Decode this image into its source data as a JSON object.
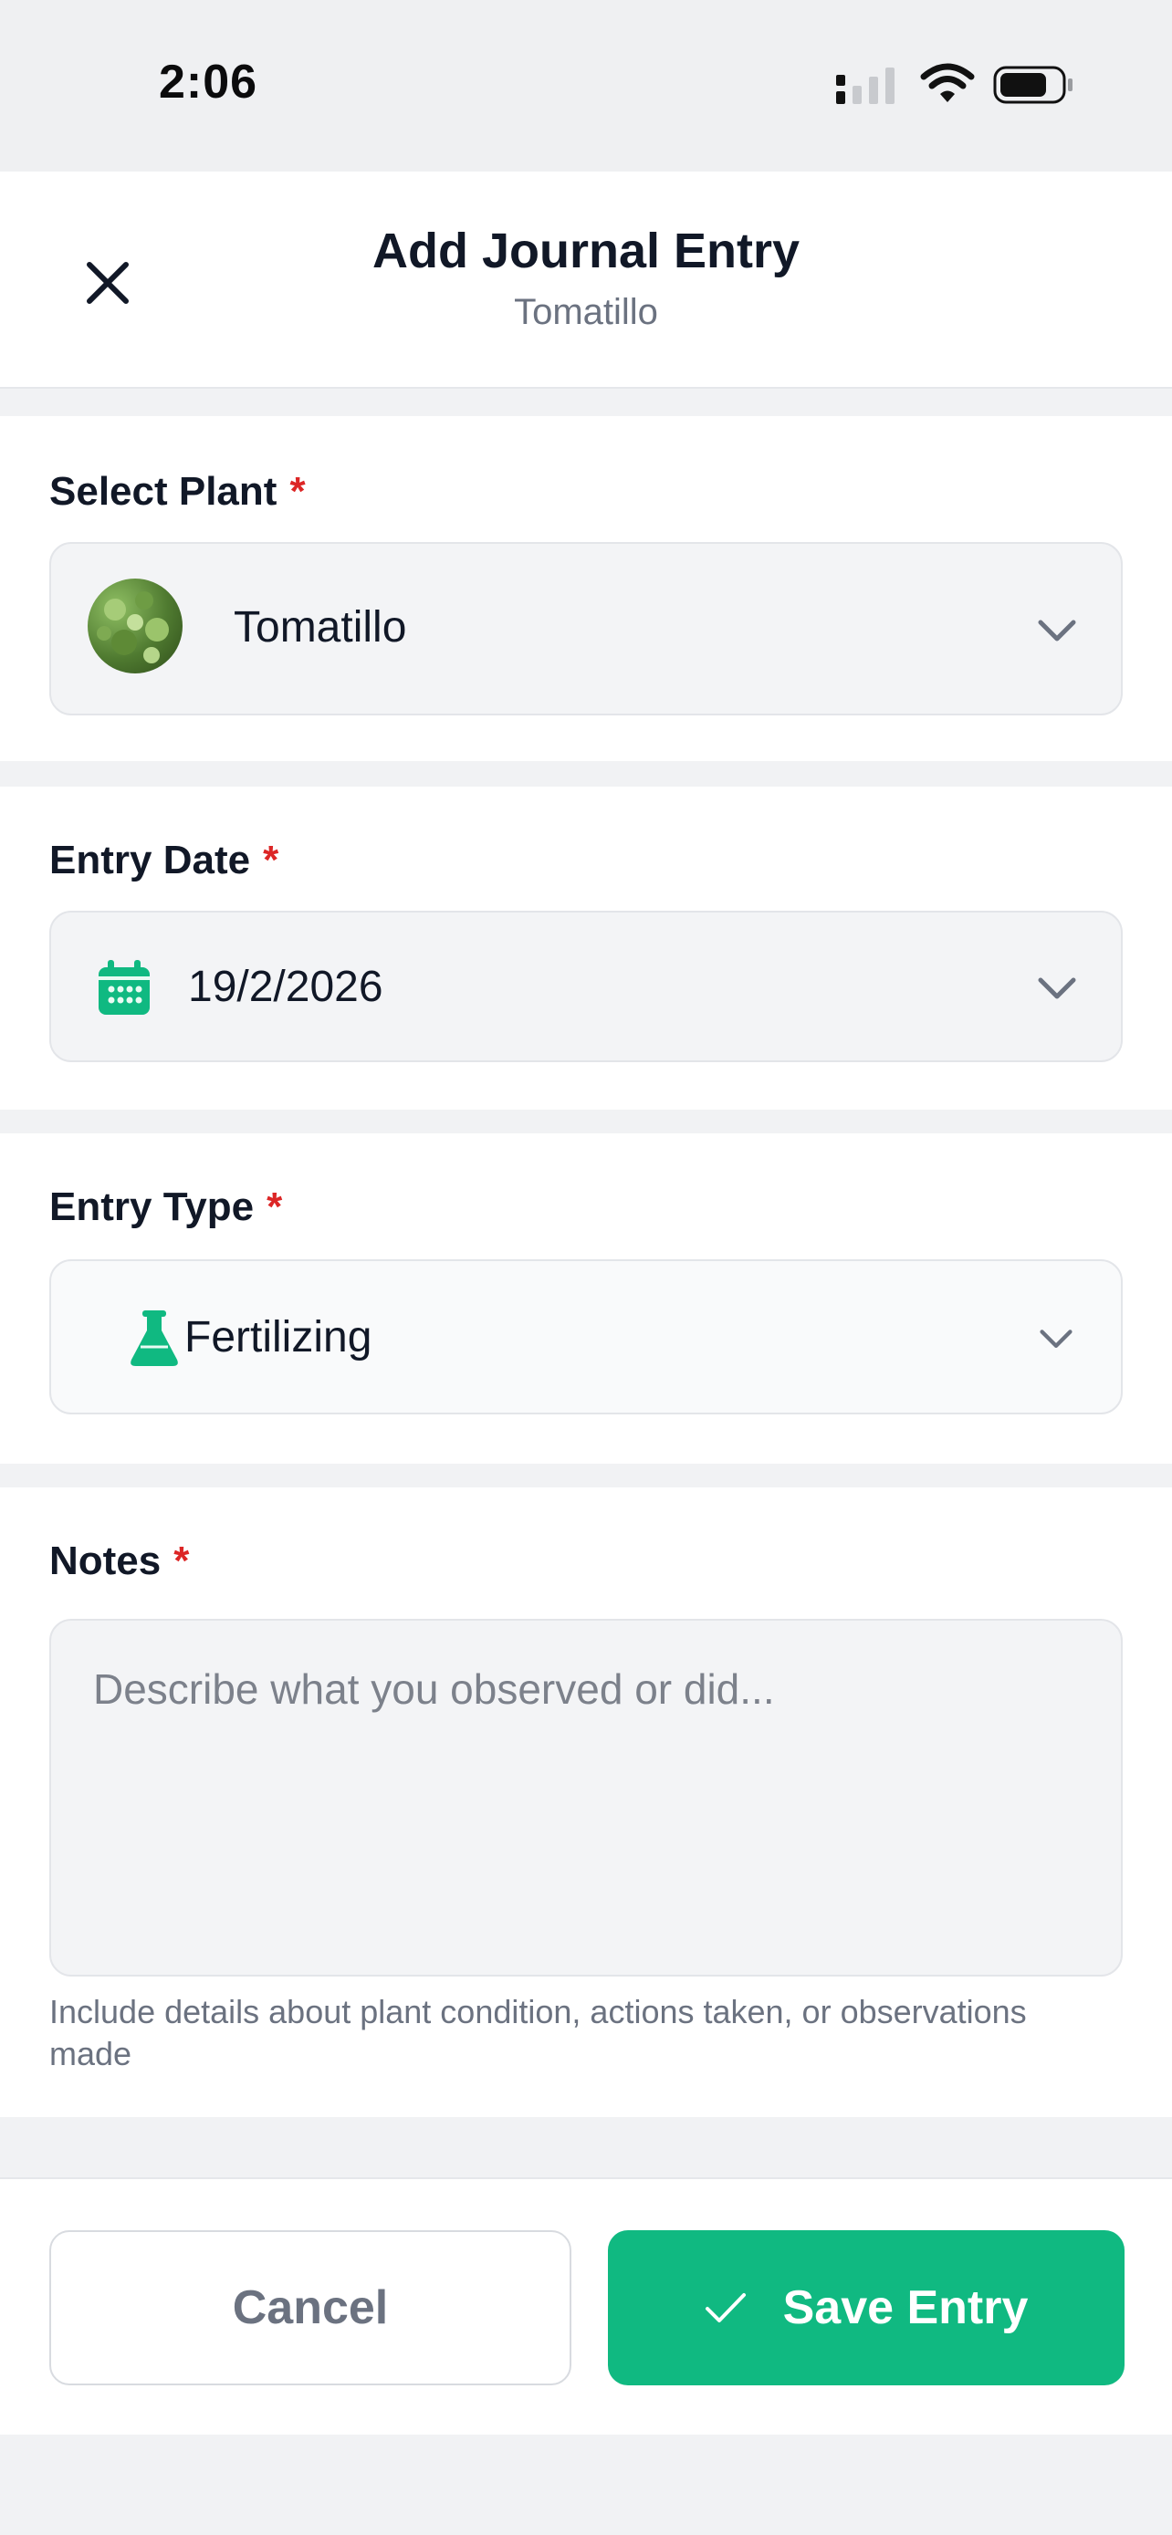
{
  "status_bar": {
    "time": "2:06",
    "icons": [
      "cellular-signal-icon",
      "wifi-icon",
      "battery-icon"
    ]
  },
  "header": {
    "title": "Add Journal Entry",
    "subtitle": "Tomatillo",
    "close_icon": "close-icon"
  },
  "form": {
    "plant": {
      "label": "Select Plant",
      "required_mark": "*",
      "value": "Tomatillo",
      "icon": "chevron-down-icon"
    },
    "entry_date": {
      "label": "Entry Date",
      "required_mark": "*",
      "value": "19/2/2026",
      "icon": "calendar-icon"
    },
    "entry_type": {
      "label": "Entry Type",
      "required_mark": "*",
      "value": "Fertilizing",
      "icon": "flask-icon"
    },
    "notes": {
      "label": "Notes",
      "required_mark": "*",
      "placeholder": "Describe what you observed or did...",
      "helper": "Include details about plant condition, actions taken, or observations made"
    }
  },
  "footer": {
    "cancel_label": "Cancel",
    "save_label": "Save Entry"
  },
  "colors": {
    "accent": "#10B981",
    "required": "#DC2626",
    "background": "#F1F2F4",
    "field_background": "#F3F4F6"
  }
}
